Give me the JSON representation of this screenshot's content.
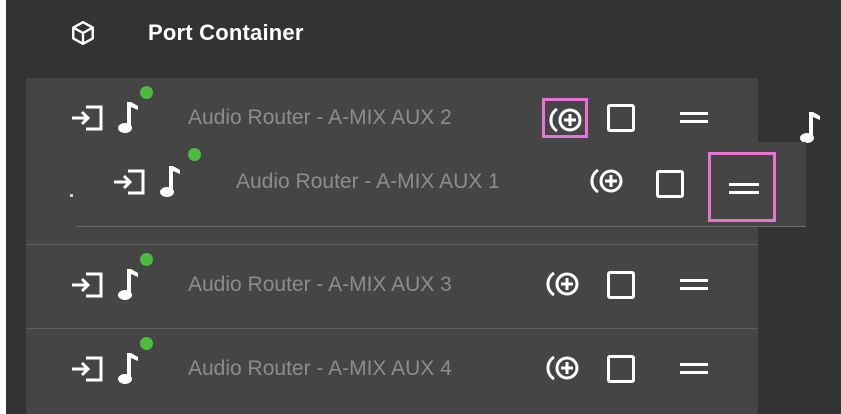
{
  "header": {
    "title": "Port Container",
    "icon": "cube-icon"
  },
  "colors": {
    "background": "#333333",
    "row": "#454545",
    "status_online": "#4cbb3f",
    "highlight": "#e774d2",
    "text_muted": "#8c8c8c"
  },
  "ports": [
    {
      "name": "Audio Router - A-MIX AUX 2",
      "status": "online"
    },
    {
      "name": "Audio Router - A-MIX AUX 1",
      "status": "online",
      "state": "dragging"
    },
    {
      "name": "Audio Router - A-MIX AUX 3",
      "status": "online"
    },
    {
      "name": "Audio Router - A-MIX AUX 4",
      "status": "online"
    }
  ],
  "icons": {
    "input": "input-icon",
    "type": "music-note-icon",
    "add": "add-broadcast-icon",
    "select": "checkbox-icon",
    "reorder": "drag-handle-icon"
  }
}
